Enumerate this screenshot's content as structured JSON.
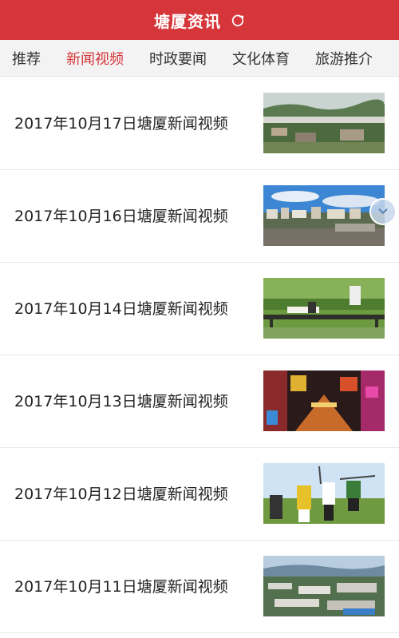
{
  "header": {
    "title": "塘厦资讯",
    "refresh_icon": "refresh-icon"
  },
  "tabs": [
    {
      "label": "推荐",
      "active": false
    },
    {
      "label": "新闻视频",
      "active": true
    },
    {
      "label": "时政要闻",
      "active": false
    },
    {
      "label": "文化体育",
      "active": false
    },
    {
      "label": "旅游推介",
      "active": false
    }
  ],
  "news": [
    {
      "title": "2017年10月17日塘厦新闻视频",
      "thumbnail": "city-highway-aerial"
    },
    {
      "title": "2017年10月16日塘厦新闻视频",
      "thumbnail": "city-skyline-blue-sky"
    },
    {
      "title": "2017年10月14日塘厦新闻视频",
      "thumbnail": "park-bridge-people"
    },
    {
      "title": "2017年10月13日塘厦新闻视频",
      "thumbnail": "night-street-neon"
    },
    {
      "title": "2017年10月12日塘厦新闻视频",
      "thumbnail": "golf-players-jumping"
    },
    {
      "title": "2017年10月11日塘厦新闻视频",
      "thumbnail": "industrial-town-aerial"
    }
  ],
  "floating_button": {
    "icon": "chevron-down-icon"
  },
  "colors": {
    "brand": "#d6353a",
    "tab_active": "#d6353a"
  }
}
